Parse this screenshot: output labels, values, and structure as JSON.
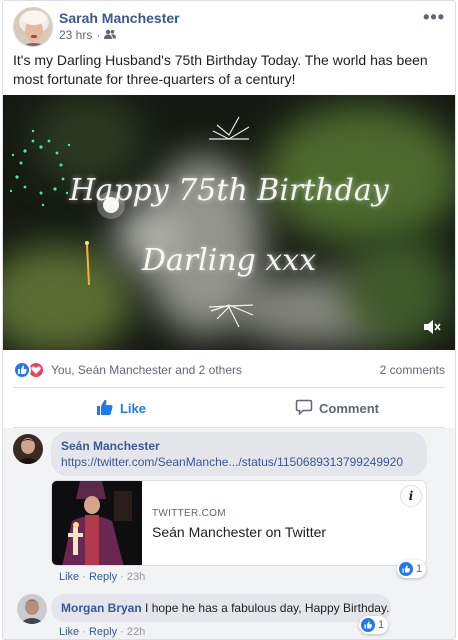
{
  "post": {
    "author": "Sarah Manchester",
    "time": "23 hrs",
    "audience_icon": "friends-icon",
    "text": "It's my Darling Husband's 75th Birthday Today. The world has been most fortunate for three-quarters of a century!",
    "more_icon": "more-options-icon",
    "more_label": "•••"
  },
  "video": {
    "line1": "Happy 75th Birthday",
    "line2": "Darling xxx",
    "mute_icon": "speaker-muted-icon"
  },
  "reactions": {
    "icons": [
      "like-reaction-icon",
      "love-reaction-icon"
    ],
    "summary": "You, Seán Manchester and 2 others",
    "comments_count": "2 comments"
  },
  "actions": {
    "like_label": "Like",
    "comment_label": "Comment"
  },
  "comments": [
    {
      "author": "Seán Manchester",
      "text": "https://twitter.com/SeanManche.../status/1150689313799249920",
      "preview": {
        "domain": "TWITTER.COM",
        "title": "Seán Manchester on Twitter",
        "info_label": "i"
      },
      "like": "Like",
      "reply": "Reply",
      "time": "23h",
      "like_count": "1"
    },
    {
      "author": "Morgan Bryan",
      "text": "I hope he has a fabulous day, Happy Birthday.",
      "like": "Like",
      "reply": "Reply",
      "time": "22h",
      "like_count": "1"
    }
  ],
  "colors": {
    "link": "#385898",
    "like_blue": "#2078f4",
    "love_red": "#f33e58",
    "text": "#1c1e21",
    "muted": "#606770"
  }
}
